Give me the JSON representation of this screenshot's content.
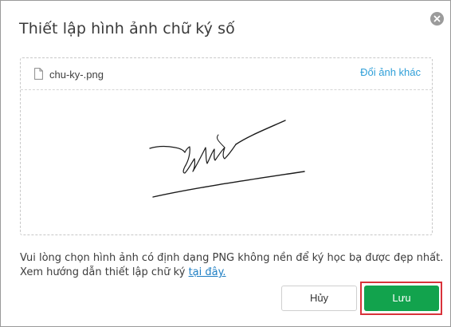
{
  "dialog": {
    "title": "Thiết lập hình ảnh chữ ký số",
    "close_icon": "close-circle-icon"
  },
  "upload": {
    "file_icon": "document-icon",
    "file_name": "chu-ky-.png",
    "change_label": "Đổi ảnh khác",
    "signature_image": "handwritten signature"
  },
  "hint": {
    "line1": "Vui lòng chọn hình ảnh có định dạng PNG không nền để ký học bạ được đẹp nhất.",
    "line2_prefix": "Xem hướng dẫn thiết lập chữ ký",
    "line2_link": "tại đây."
  },
  "actions": {
    "cancel_label": "Hủy",
    "save_label": "Lưu"
  },
  "colors": {
    "accent_link": "#2f9fd8",
    "save_bg": "#12a34d",
    "highlight": "#d9323a"
  }
}
